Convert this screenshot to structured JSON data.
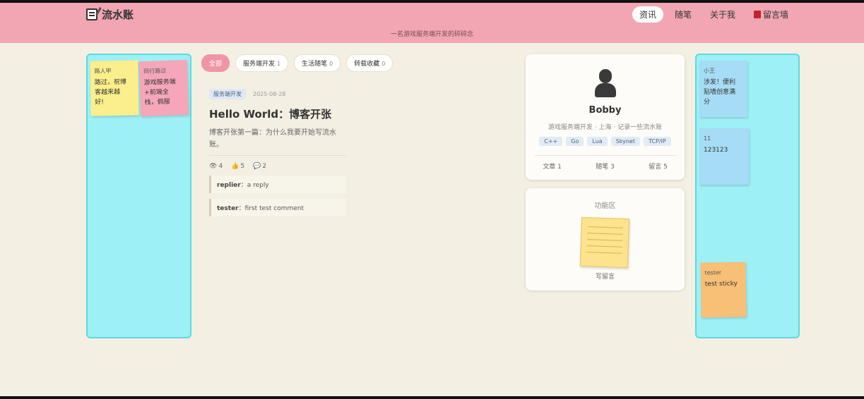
{
  "header": {
    "brand_title": "流水账",
    "subtitle": "一名游戏服务端开发的碎碎念",
    "nav": [
      {
        "label": "资讯",
        "active": true
      },
      {
        "label": "随笔",
        "active": false
      },
      {
        "label": "关于我",
        "active": false
      },
      {
        "label": "留言墙",
        "active": false
      }
    ]
  },
  "left_stickies": [
    {
      "author": "路人甲",
      "text": "路过，祝博\n客越来越\n好!",
      "color": "#fbee8c"
    },
    {
      "author": "同行路过",
      "text": "游戏服务端\n+前端全\n栈，佩服",
      "color": "#f5a7b9"
    }
  ],
  "right_stickies": [
    {
      "author": "小王",
      "text": "涉发！便利\n贴墙创意满\n分",
      "color": "#a6dcf5"
    },
    {
      "author": "11",
      "text": "123123",
      "color": "#a6dcf5"
    },
    {
      "author": "tester",
      "text": "test sticky",
      "color": "#f8bf77"
    }
  ],
  "filters": [
    {
      "label": "全部",
      "count": "",
      "active": true
    },
    {
      "label": "服务端开发",
      "count": "1",
      "active": false
    },
    {
      "label": "生活随笔",
      "count": "0",
      "active": false
    },
    {
      "label": "转载收藏",
      "count": "0",
      "active": false
    }
  ],
  "post": {
    "tag": "服务端开发",
    "date": "2025-08-28",
    "title": "Hello World：博客开张",
    "excerpt": "博客开张第一篇：为什么我要开始写流水账。",
    "views": "4",
    "likes": "5",
    "comments_count": "2",
    "comments": [
      {
        "author": "replier",
        "text": "a reply"
      },
      {
        "author": "tester",
        "text": "first test comment"
      }
    ]
  },
  "profile": {
    "name": "Bobby",
    "bio": "游戏服务端开发 · 上海 · 记录一些流水账",
    "skills": [
      "C++",
      "Go",
      "Lua",
      "Skynet",
      "TCP/IP"
    ],
    "stats": {
      "articles": "文章 1",
      "essays": "随笔 3",
      "messages": "留言 5"
    }
  },
  "function_area": {
    "title": "功能区",
    "memo_label": "写留言"
  }
}
